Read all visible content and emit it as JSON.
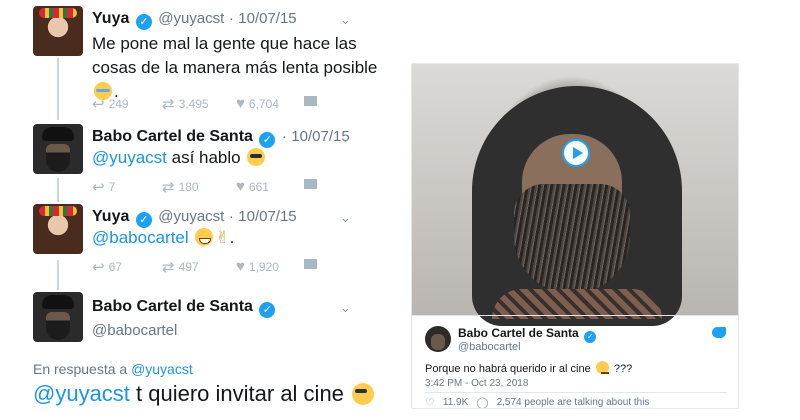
{
  "thread": {
    "tweets": [
      {
        "name": "Yuya",
        "handle": "@yuyacst",
        "dot": "·",
        "date": "10/07/15",
        "line1": "Me pone mal la gente que hace las",
        "line2": "cosas de la manera más lenta posible",
        "line3_end": ".",
        "emoji": "crying-laughing-emoji",
        "replies": "249",
        "retweets": "3,495",
        "likes": "6,704"
      },
      {
        "name": "Babo Cartel de Santa",
        "date": "10/07/15",
        "dot": "·",
        "mention": "@yuyacst",
        "text": " así hablo ",
        "emoji": "sunglasses-emoji",
        "replies": "7",
        "retweets": "180",
        "likes": "661"
      },
      {
        "name": "Yuya",
        "handle": "@yuyacst",
        "dot": "·",
        "date": "10/07/15",
        "mention": "@babocartel",
        "text_end": ".",
        "emoji": "grinning-emoji",
        "emoji2": "victory-hand-emoji",
        "replies": "67",
        "retweets": "497",
        "likes": "1,920"
      },
      {
        "name": "Babo Cartel de Santa",
        "handle": "@babocartel",
        "reply_to_prefix": "En respuesta a ",
        "reply_to_handle": "@yuyacst",
        "mention": "@yuyacst",
        "text": " t quiero invitar al cine ",
        "emoji": "sunglasses-emoji"
      }
    ]
  },
  "card": {
    "name": "Babo Cartel de Santa",
    "handle": "@babocartel",
    "text": "Porque no habrá querido ir al cine ",
    "text_end": " ???",
    "emoji": "thinking-face-emoji",
    "timestamp": "3:42 PM - Oct 23, 2018",
    "likes": "11.9K",
    "talking": "2,574 people are talking about this"
  },
  "colors": {
    "link": "#1b95e0",
    "verified": "#1da1f2",
    "muted": "#657786",
    "action": "#aab8c2"
  }
}
